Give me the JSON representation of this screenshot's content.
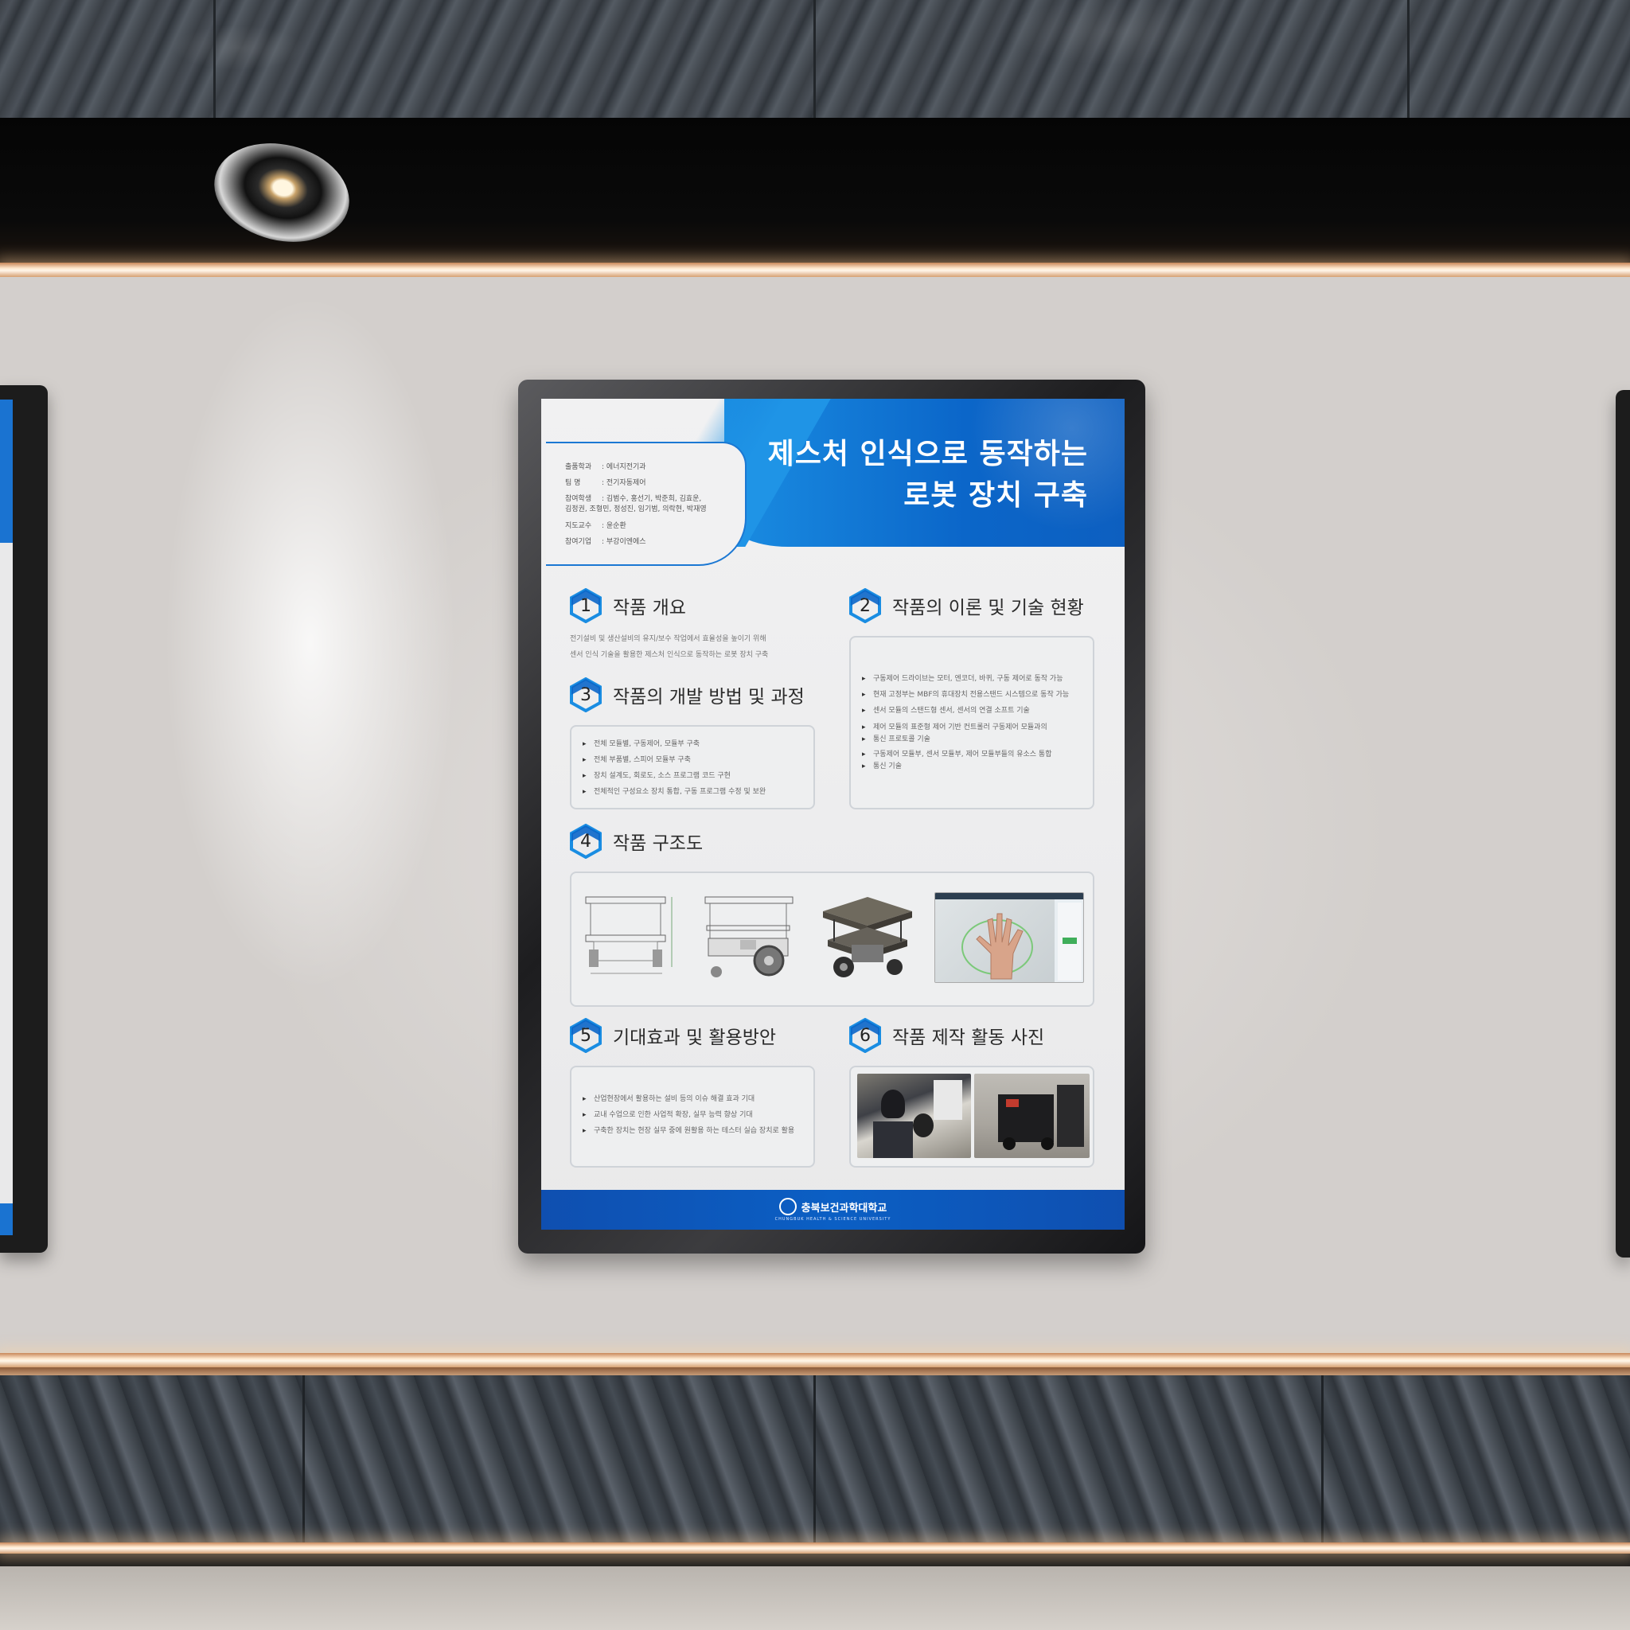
{
  "poster": {
    "title_line1": "제스처 인식으로 동작하는",
    "title_line2": "로봇 장치 구축",
    "info": [
      {
        "key": "출품학과",
        "value": ": 에너지전기과"
      },
      {
        "key": "팀      명",
        "value": ": 전기자동제어"
      },
      {
        "key": "참여학생",
        "value": ": 김범수, 홍선기, 박준희, 김효운,"
      },
      {
        "key": "",
        "value": "김정권, 조형민, 정성진, 임기범, 의락현, 박재영"
      },
      {
        "key": "지도교수",
        "value": ": 윤순환"
      },
      {
        "key": "참여기업",
        "value": ": 부강이엔에스"
      }
    ],
    "sections": {
      "s1": {
        "num": "1",
        "title": "작품 개요",
        "text": [
          "전기설비 및 생산설비의 유지/보수 작업에서 효율성을 높이기 위해",
          "센서 인식 기술을 활용한 제스처 인식으로 동작하는 로봇 장치 구축"
        ]
      },
      "s2": {
        "num": "2",
        "title": "작품의 이론 및 기술 현황",
        "bullets": [
          "구동제어 드라이브는 모터, 엔코더, 바퀴, 구동 제어로 동작 가능",
          "현재 고정부는 MBF의 휴대장치 전용스탠드 시스템으로 동작 가능",
          "센서 모듈의 스탠드형 센서, 센서의 연결 소프트 기술",
          "제어 모듈의 표준형 제어 기반 컨트롤러 구동제어 모듈과의",
          "통신 프로토콜 기술",
          "구동제어 모듈부, 센서 모듈부, 제어 모듈부들의 유소스 통합",
          "통신 기술"
        ]
      },
      "s3": {
        "num": "3",
        "title": "작품의 개발 방법 및 과정",
        "bullets": [
          "전체 모듈별, 구동제어, 모듈부 구축",
          "전체 부품별, 스피어 모듈부 구축",
          "장치 설계도, 회로도, 소스 프로그램 코드 구현",
          "전체적인 구성요소 장치 통합, 구동 프로그램 수정 및 보완"
        ]
      },
      "s4": {
        "num": "4",
        "title": "작품 구조도"
      },
      "s5": {
        "num": "5",
        "title": "기대효과 및 활용방안",
        "bullets": [
          "산업현장에서 활용하는 설비 등의 이슈 해결 효과 기대",
          "교내 수업으로 인한 사업적 확장, 실무 능력 향상 기대",
          "구축한 장치는 현장 실무 중에 원활용 하는 테스터 실습 장치로 활용"
        ]
      },
      "s6": {
        "num": "6",
        "title": "작품 제작 활동 사진"
      }
    },
    "footer": {
      "school_name": "충북보건과학대학교",
      "school_sub": "CHUNGBUK HEALTH & SCIENCE UNIVERSITY"
    }
  },
  "colors": {
    "accent_blue": "#0b66c9",
    "light_blue": "#1a8de2",
    "footer_blue": "#0f4fb0"
  }
}
